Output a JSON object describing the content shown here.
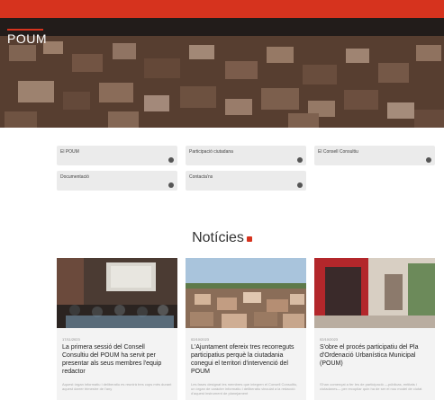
{
  "header": {
    "logo_text": "POUM",
    "accent_color": "#d6331e"
  },
  "quick_links": [
    {
      "label": "El POUM",
      "icon": "arrow-circle-icon"
    },
    {
      "label": "Participació ciutadana",
      "icon": "arrow-circle-icon"
    },
    {
      "label": "El Consell Consultiu",
      "icon": "arrow-circle-icon"
    },
    {
      "label": "Documentació",
      "icon": "arrow-circle-icon"
    },
    {
      "label": "Contacta'ns",
      "icon": "arrow-circle-icon"
    }
  ],
  "news": {
    "section_title": "Notícies",
    "rss_icon": "rss-icon",
    "items": [
      {
        "date": "17/11/2023",
        "title": "La primera sessió del Consell Consultiu del POUM ha servit per presentar als seus membres l'equip redactor",
        "excerpt": "Aquest òrgan informatiu i deliberatiu es reunirà tres cops més durant aquest darrer trimestre de l'any"
      },
      {
        "date": "02/10/2023",
        "title": "L'Ajuntament ofereix tres recorreguts participatius perquè la ciutadania conegui el territori d'intervenció del POUM",
        "excerpt": "Les fases designat les membres que integren el Consell Consultiu, un òrgan de caràcter informatiu i deliberatiu vinculat a la redacció d'aquest instrument de planejament"
      },
      {
        "date": "02/10/2023",
        "title": "S'obre el procés participatiu del Pla d'Ordenació Urbanística Municipal (POUM)",
        "excerpt": "S'han començat a fer les de participació —públicas, entitats i ciutadanes— per recopilar quin ha de ser el nou model de ciutat"
      }
    ]
  }
}
